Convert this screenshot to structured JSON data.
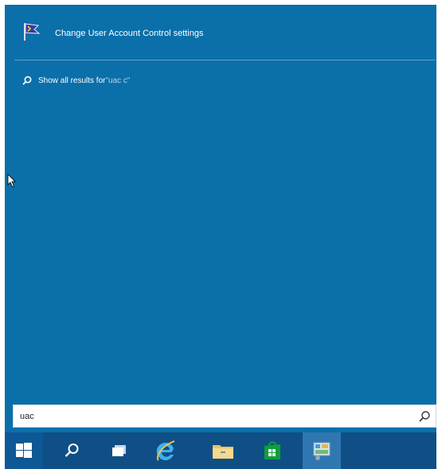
{
  "results": {
    "top_item": {
      "label": "Change User Account Control settings",
      "icon": "uac-flag-icon"
    },
    "show_all": {
      "prefix": "Show all results for ",
      "query": "\"uac c\"",
      "icon": "search-icon"
    }
  },
  "search_box": {
    "value": "uac",
    "icon": "search-icon"
  },
  "taskbar": {
    "items": [
      {
        "name": "start",
        "icon": "windows-logo-icon"
      },
      {
        "name": "search",
        "icon": "search-icon"
      },
      {
        "name": "task-view",
        "icon": "task-view-icon"
      },
      {
        "name": "internet-explorer",
        "icon": "internet-explorer-icon"
      },
      {
        "name": "file-explorer",
        "icon": "folder-icon"
      },
      {
        "name": "store",
        "icon": "store-icon"
      },
      {
        "name": "control-panel",
        "icon": "control-panel-icon"
      }
    ]
  },
  "colors": {
    "panel_bg": "#0b6faa",
    "taskbar_bg": "#0f4f86",
    "text": "#ffffff"
  }
}
